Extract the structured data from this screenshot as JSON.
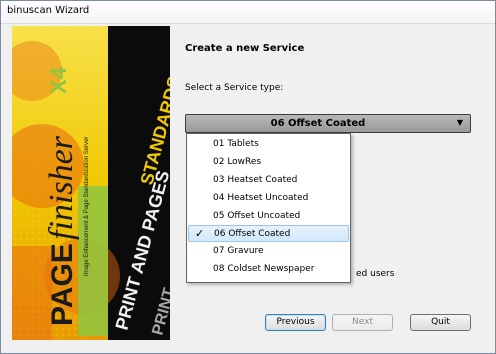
{
  "window": {
    "title": "binuscan Wizard"
  },
  "banner": {
    "product_prefix": "PAGE",
    "product_name": "finisher",
    "version": "X4",
    "tagline": "Image Enhancement & Page Standardization Server",
    "side_text_1": "PRINT AND PAGES",
    "side_text_2": "STANDARDS",
    "side_text_3": "PRINT"
  },
  "content": {
    "heading": "Create a new Service",
    "service_type_label": "Select a Service type:",
    "selected_service": "06 Offset Coated",
    "service_options": [
      "01 Tablets",
      "02 LowRes",
      "03 Heatset Coated",
      "04 Heatset Uncoated",
      "05 Offset Uncoated",
      "06 Offset Coated",
      "07 Gravure",
      "08 Coldset Newspaper"
    ],
    "partially_hidden_text": "ed users"
  },
  "buttons": {
    "previous": "Previous",
    "next": "Next",
    "quit": "Quit"
  },
  "colors": {
    "banner_yellow": "#f5d800",
    "banner_orange": "#e86a10",
    "banner_green": "#8ec63f",
    "combo_bg": "#a8a8a8",
    "selection_bg": "#dcecfb"
  }
}
